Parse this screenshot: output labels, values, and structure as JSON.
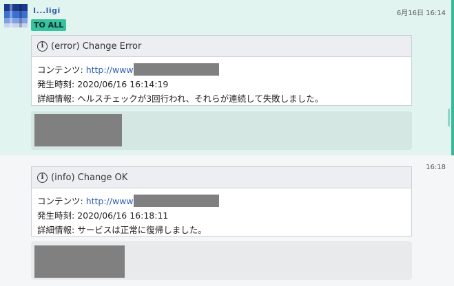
{
  "messages": [
    {
      "sender": "I...ligi",
      "time": "6月16日 16:14",
      "badge": "TO ALL",
      "card": {
        "title": "(error) Change Error",
        "content_label": "コンテンツ: ",
        "content_link": "http://www",
        "time_label": "発生時刻: ",
        "time_value": "2020/06/16 16:14:19",
        "detail_label": "詳細情報: ",
        "detail_value": "ヘルスチェックが3回行われ、それらが連続して失敗しました。"
      }
    },
    {
      "time": "16:18",
      "card": {
        "title": "(info) Change OK",
        "content_label": "コンテンツ: ",
        "content_link": "http://www",
        "time_label": "発生時刻: ",
        "time_value": "2020/06/16 16:18:11",
        "detail_label": "詳細情報: ",
        "detail_value": "サービスは正常に復帰しました。"
      }
    }
  ],
  "icons": {
    "info": "i"
  },
  "colors": {
    "highlight_bg": "#e2f4ef",
    "accent": "#37b99a",
    "badge_bg": "#37c19f",
    "link": "#2f5fb3",
    "redaction": "#808080"
  }
}
